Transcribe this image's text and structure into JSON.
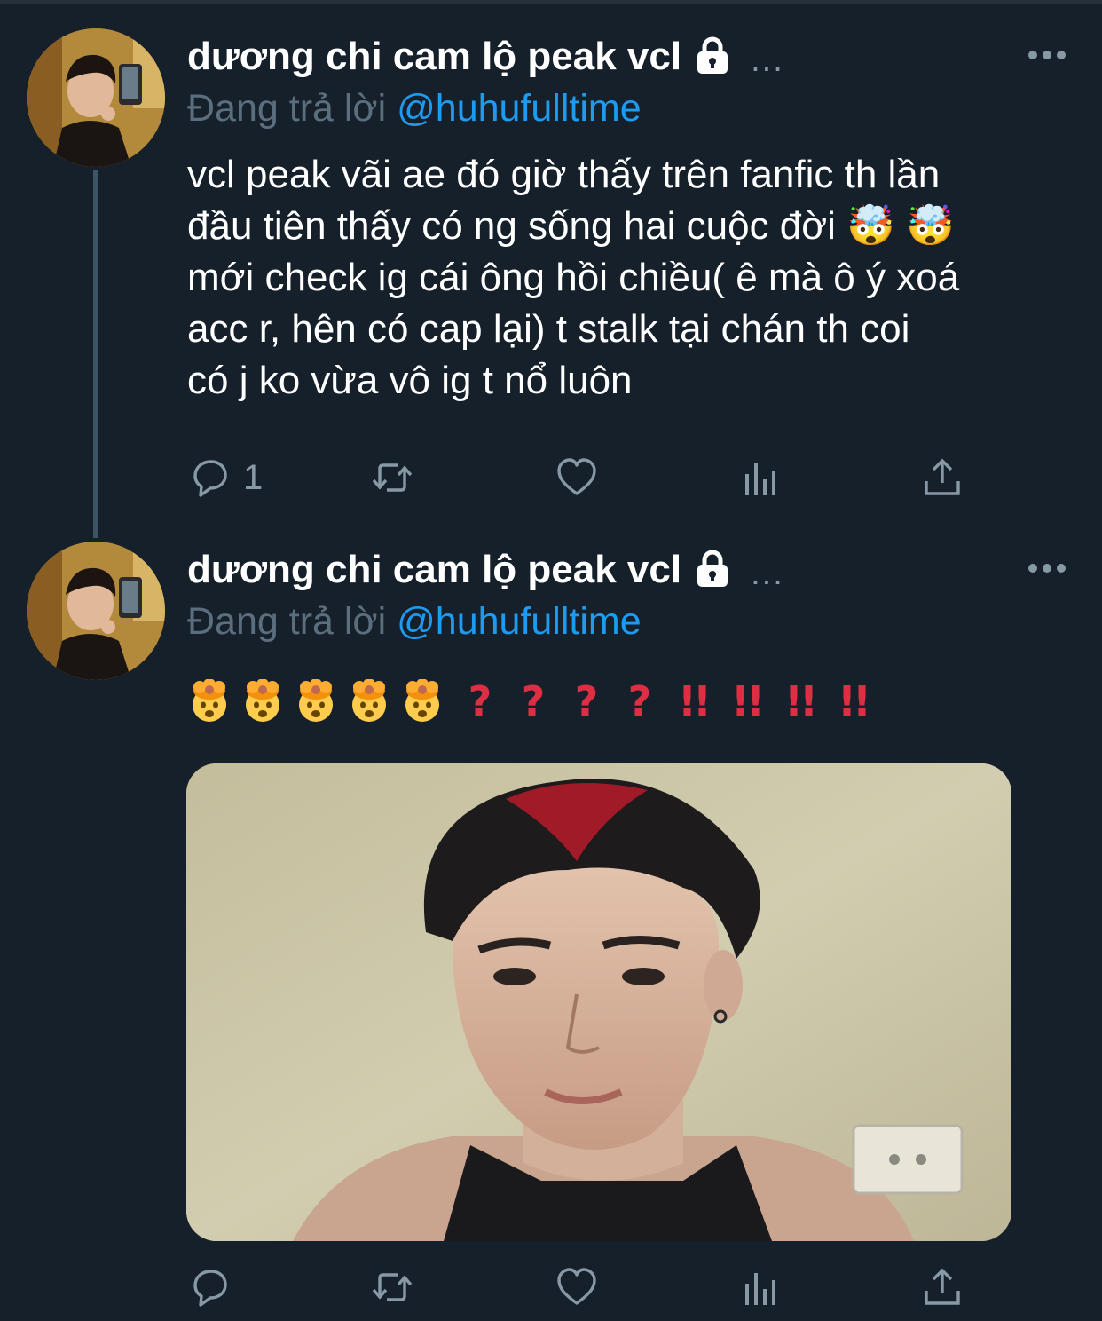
{
  "colors": {
    "background": "#15202b",
    "text_primary": "#ffffff",
    "text_secondary": "#8899a6",
    "link": "#1d9bf0",
    "thread_line": "#3d5466",
    "punctuation_red": "#dd2e44"
  },
  "tweets": [
    {
      "author_name": "dương chi cam lộ peak vcl",
      "protected_icon": "lock-icon",
      "inline_dots": "...",
      "reply_prefix": "Đang trả lời",
      "reply_handle": "@huhufulltime",
      "text": "vcl peak vãi ae đó giờ thấy trên fanfic th lần\nđầu tiên thấy có ng sống hai cuộc đời 🤯 🤯\nmới check ig cái ông hồi chiều( ê mà ô ý xoá\nacc r, hên có cap lại) t stalk tại chán th coi\ncó j ko vừa vô ig t nổ luôn",
      "actions": {
        "reply_count": "1",
        "retweet_count": "",
        "like_count": ""
      }
    },
    {
      "author_name": "dương chi cam lộ peak vcl",
      "protected_icon": "lock-icon",
      "inline_dots": "...",
      "reply_prefix": "Đang trả lời",
      "reply_handle": "@huhufulltime",
      "emoji_text": [
        "🤯",
        "🤯",
        "🤯",
        "🤯",
        "🤯",
        "?",
        "?",
        "?",
        "?",
        "!!",
        "!!",
        "!!",
        "!!"
      ],
      "has_photo": true,
      "actions": {
        "reply_count": "",
        "retweet_count": "",
        "like_count": ""
      }
    }
  ],
  "icons": {
    "more": "more-horizontal-icon",
    "reply": "reply-icon",
    "retweet": "retweet-icon",
    "like": "heart-icon",
    "analytics": "analytics-icon",
    "share": "share-icon",
    "mind_blown": "exploding-head-emoji"
  }
}
